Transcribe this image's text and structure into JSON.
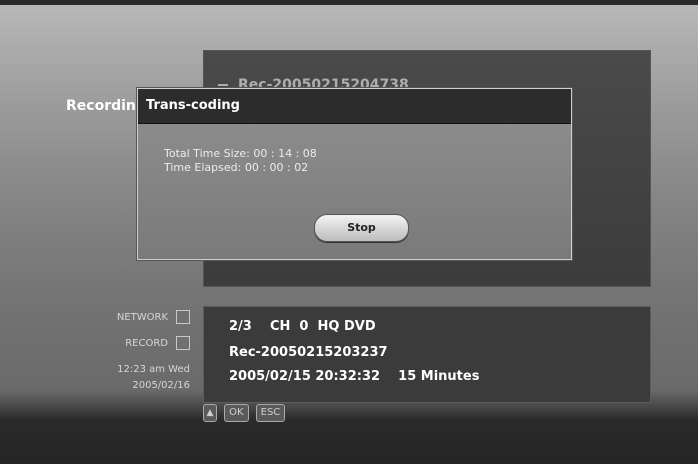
{
  "list": {
    "item": "Rec-20050215204738"
  },
  "side_title": "Recording",
  "dialog": {
    "title": "Trans-coding",
    "total_time": "Total Time Size: 00 : 14 : 08",
    "elapsed": "Time Elapsed: 00 : 00 : 02",
    "stop_label": "Stop"
  },
  "status": {
    "network": "NETWORK",
    "record": "RECORD",
    "time": "12:23 am Wed",
    "date": "2005/02/16"
  },
  "info": {
    "line1": "2/3    CH  0  HQ DVD",
    "line2": "Rec-20050215203237",
    "line3": "2005/02/15 20:32:32    15 Minutes"
  },
  "keys": {
    "ok": "OK",
    "esc": "ESC"
  },
  "icons": {
    "nav": "up-down-arrows-icon",
    "network": "network-indicator-icon",
    "record": "record-indicator-icon"
  }
}
